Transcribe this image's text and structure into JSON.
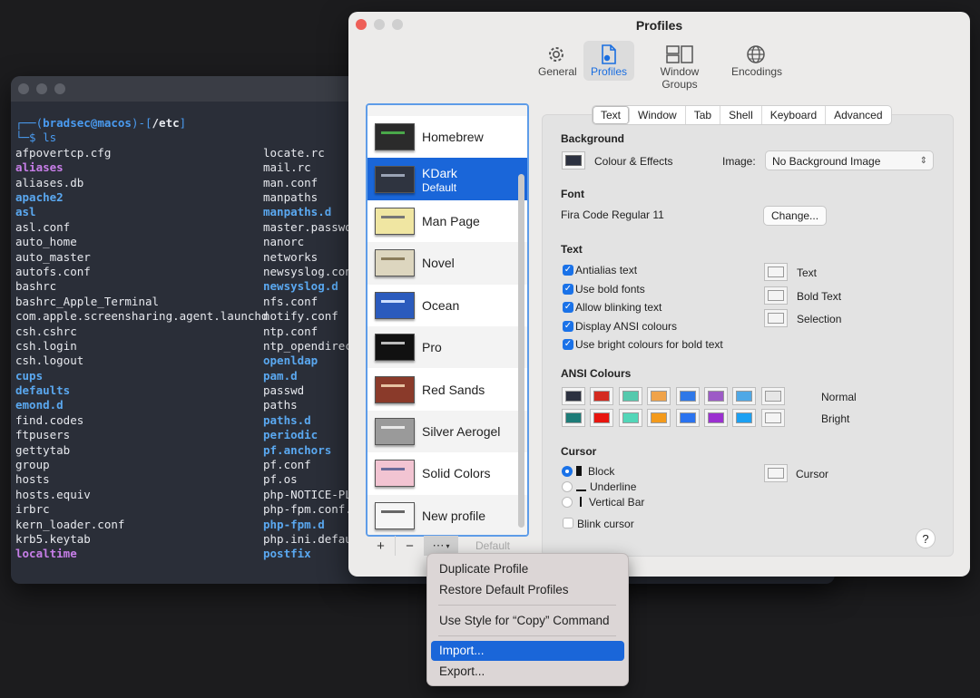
{
  "terminal": {
    "prompt_user": "bradsec@macos",
    "prompt_path": "/etc",
    "command": "ls",
    "col1": [
      {
        "t": "afpovertcp.cfg",
        "k": ""
      },
      {
        "t": "aliases",
        "k": "link"
      },
      {
        "t": "aliases.db",
        "k": ""
      },
      {
        "t": "apache2",
        "k": "dir"
      },
      {
        "t": "asl",
        "k": "dir"
      },
      {
        "t": "asl.conf",
        "k": ""
      },
      {
        "t": "auto_home",
        "k": ""
      },
      {
        "t": "auto_master",
        "k": ""
      },
      {
        "t": "autofs.conf",
        "k": ""
      },
      {
        "t": "bashrc",
        "k": ""
      },
      {
        "t": "bashrc_Apple_Terminal",
        "k": ""
      },
      {
        "t": "com.apple.screensharing.agent.launchd",
        "k": ""
      },
      {
        "t": "csh.cshrc",
        "k": ""
      },
      {
        "t": "csh.login",
        "k": ""
      },
      {
        "t": "csh.logout",
        "k": ""
      },
      {
        "t": "cups",
        "k": "dir"
      },
      {
        "t": "defaults",
        "k": "dir"
      },
      {
        "t": "emond.d",
        "k": "dir"
      },
      {
        "t": "find.codes",
        "k": ""
      },
      {
        "t": "ftpusers",
        "k": ""
      },
      {
        "t": "gettytab",
        "k": ""
      },
      {
        "t": "group",
        "k": ""
      },
      {
        "t": "hosts",
        "k": ""
      },
      {
        "t": "hosts.equiv",
        "k": ""
      },
      {
        "t": "irbrc",
        "k": ""
      },
      {
        "t": "kern_loader.conf",
        "k": ""
      },
      {
        "t": "krb5.keytab",
        "k": ""
      },
      {
        "t": "localtime",
        "k": "link"
      }
    ],
    "col2": [
      {
        "t": "locate.rc",
        "k": ""
      },
      {
        "t": "mail.rc",
        "k": ""
      },
      {
        "t": "man.conf",
        "k": ""
      },
      {
        "t": "manpaths",
        "k": ""
      },
      {
        "t": "manpaths.d",
        "k": "dir"
      },
      {
        "t": "master.passwd",
        "k": ""
      },
      {
        "t": "nanorc",
        "k": ""
      },
      {
        "t": "networks",
        "k": ""
      },
      {
        "t": "newsyslog.conf",
        "k": ""
      },
      {
        "t": "newsyslog.d",
        "k": "dir"
      },
      {
        "t": "nfs.conf",
        "k": ""
      },
      {
        "t": "notify.conf",
        "k": ""
      },
      {
        "t": "ntp.conf",
        "k": ""
      },
      {
        "t": "ntp_opendirectory",
        "k": ""
      },
      {
        "t": "openldap",
        "k": "dir"
      },
      {
        "t": "pam.d",
        "k": "dir"
      },
      {
        "t": "passwd",
        "k": ""
      },
      {
        "t": "paths",
        "k": ""
      },
      {
        "t": "paths.d",
        "k": "dir"
      },
      {
        "t": "periodic",
        "k": "dir"
      },
      {
        "t": "pf.anchors",
        "k": "dir"
      },
      {
        "t": "pf.conf",
        "k": ""
      },
      {
        "t": "pf.os",
        "k": ""
      },
      {
        "t": "php-NOTICE-PLIST",
        "k": ""
      },
      {
        "t": "php-fpm.conf.default",
        "k": ""
      },
      {
        "t": "php-fpm.d",
        "k": "dir"
      },
      {
        "t": "php.ini.default",
        "k": ""
      },
      {
        "t": "postfix",
        "k": "dir"
      }
    ]
  },
  "prefs": {
    "title": "Profiles",
    "toolbar": [
      {
        "label": "General",
        "icon": "gear-icon"
      },
      {
        "label": "Profiles",
        "icon": "profiles-icon"
      },
      {
        "label": "Window Groups",
        "icon": "window-groups-icon"
      },
      {
        "label": "Encodings",
        "icon": "globe-icon"
      }
    ],
    "profiles": [
      {
        "name": "Homebrew",
        "thumb": "#2b2b2b",
        "bar": "#4aa84a"
      },
      {
        "name": "KDark",
        "sub": "Default",
        "thumb": "#2f3440",
        "bar": "#9aa3b5",
        "selected": true
      },
      {
        "name": "Man Page",
        "thumb": "#f0e6a2",
        "bar": "#777"
      },
      {
        "name": "Novel",
        "thumb": "#ddd6bf",
        "bar": "#8a7c5b"
      },
      {
        "name": "Ocean",
        "thumb": "#2b5bbd",
        "bar": "#cfe0ff"
      },
      {
        "name": "Pro",
        "thumb": "#111111",
        "bar": "#bbbbbb"
      },
      {
        "name": "Red Sands",
        "thumb": "#8a3a2a",
        "bar": "#e7c2a2"
      },
      {
        "name": "Silver Aerogel",
        "thumb": "#9a9a9a",
        "bar": "#e8e8e8"
      },
      {
        "name": "Solid Colors",
        "thumb": "#f2c4d2",
        "bar": "#6a6a9a"
      },
      {
        "name": "New profile",
        "thumb": "#f5f5f5",
        "bar": "#666"
      }
    ],
    "list_buttons": {
      "add": "+",
      "remove": "−",
      "more": "⋯",
      "default": "Default"
    },
    "tabs": [
      "Text",
      "Window",
      "Tab",
      "Shell",
      "Keyboard",
      "Advanced"
    ],
    "background": {
      "section": "Background",
      "colour_label": "Colour & Effects",
      "image_label": "Image:",
      "image_value": "No Background Image"
    },
    "font": {
      "section": "Font",
      "value": "Fira Code Regular 11",
      "change": "Change..."
    },
    "text": {
      "section": "Text",
      "checks": [
        "Antialias text",
        "Use bold fonts",
        "Allow blinking text",
        "Display ANSI colours",
        "Use bright colours for bold text"
      ],
      "colours": [
        "Text",
        "Bold Text",
        "Selection"
      ]
    },
    "ansi": {
      "section": "ANSI Colours",
      "normal_label": "Normal",
      "bright_label": "Bright",
      "normal": [
        "#2c3140",
        "#d42b20",
        "#55c9ad",
        "#f0a34a",
        "#2f78e8",
        "#9d5bc6",
        "#4fa8e6",
        "#e6e6e6"
      ],
      "bright": [
        "#1d7c78",
        "#e8150f",
        "#52d6b8",
        "#f39a1b",
        "#2a73ef",
        "#9b30d0",
        "#1ba0f2",
        "#f4f4f4"
      ]
    },
    "cursor": {
      "section": "Cursor",
      "options": [
        "Block",
        "Underline",
        "Vertical Bar"
      ],
      "blink": "Blink cursor",
      "colour": "Cursor"
    },
    "help": "?"
  },
  "menu": {
    "items": [
      "Duplicate Profile",
      "Restore Default Profiles",
      "Use Style for “Copy” Command",
      "Import...",
      "Export..."
    ],
    "highlighted": 3
  }
}
